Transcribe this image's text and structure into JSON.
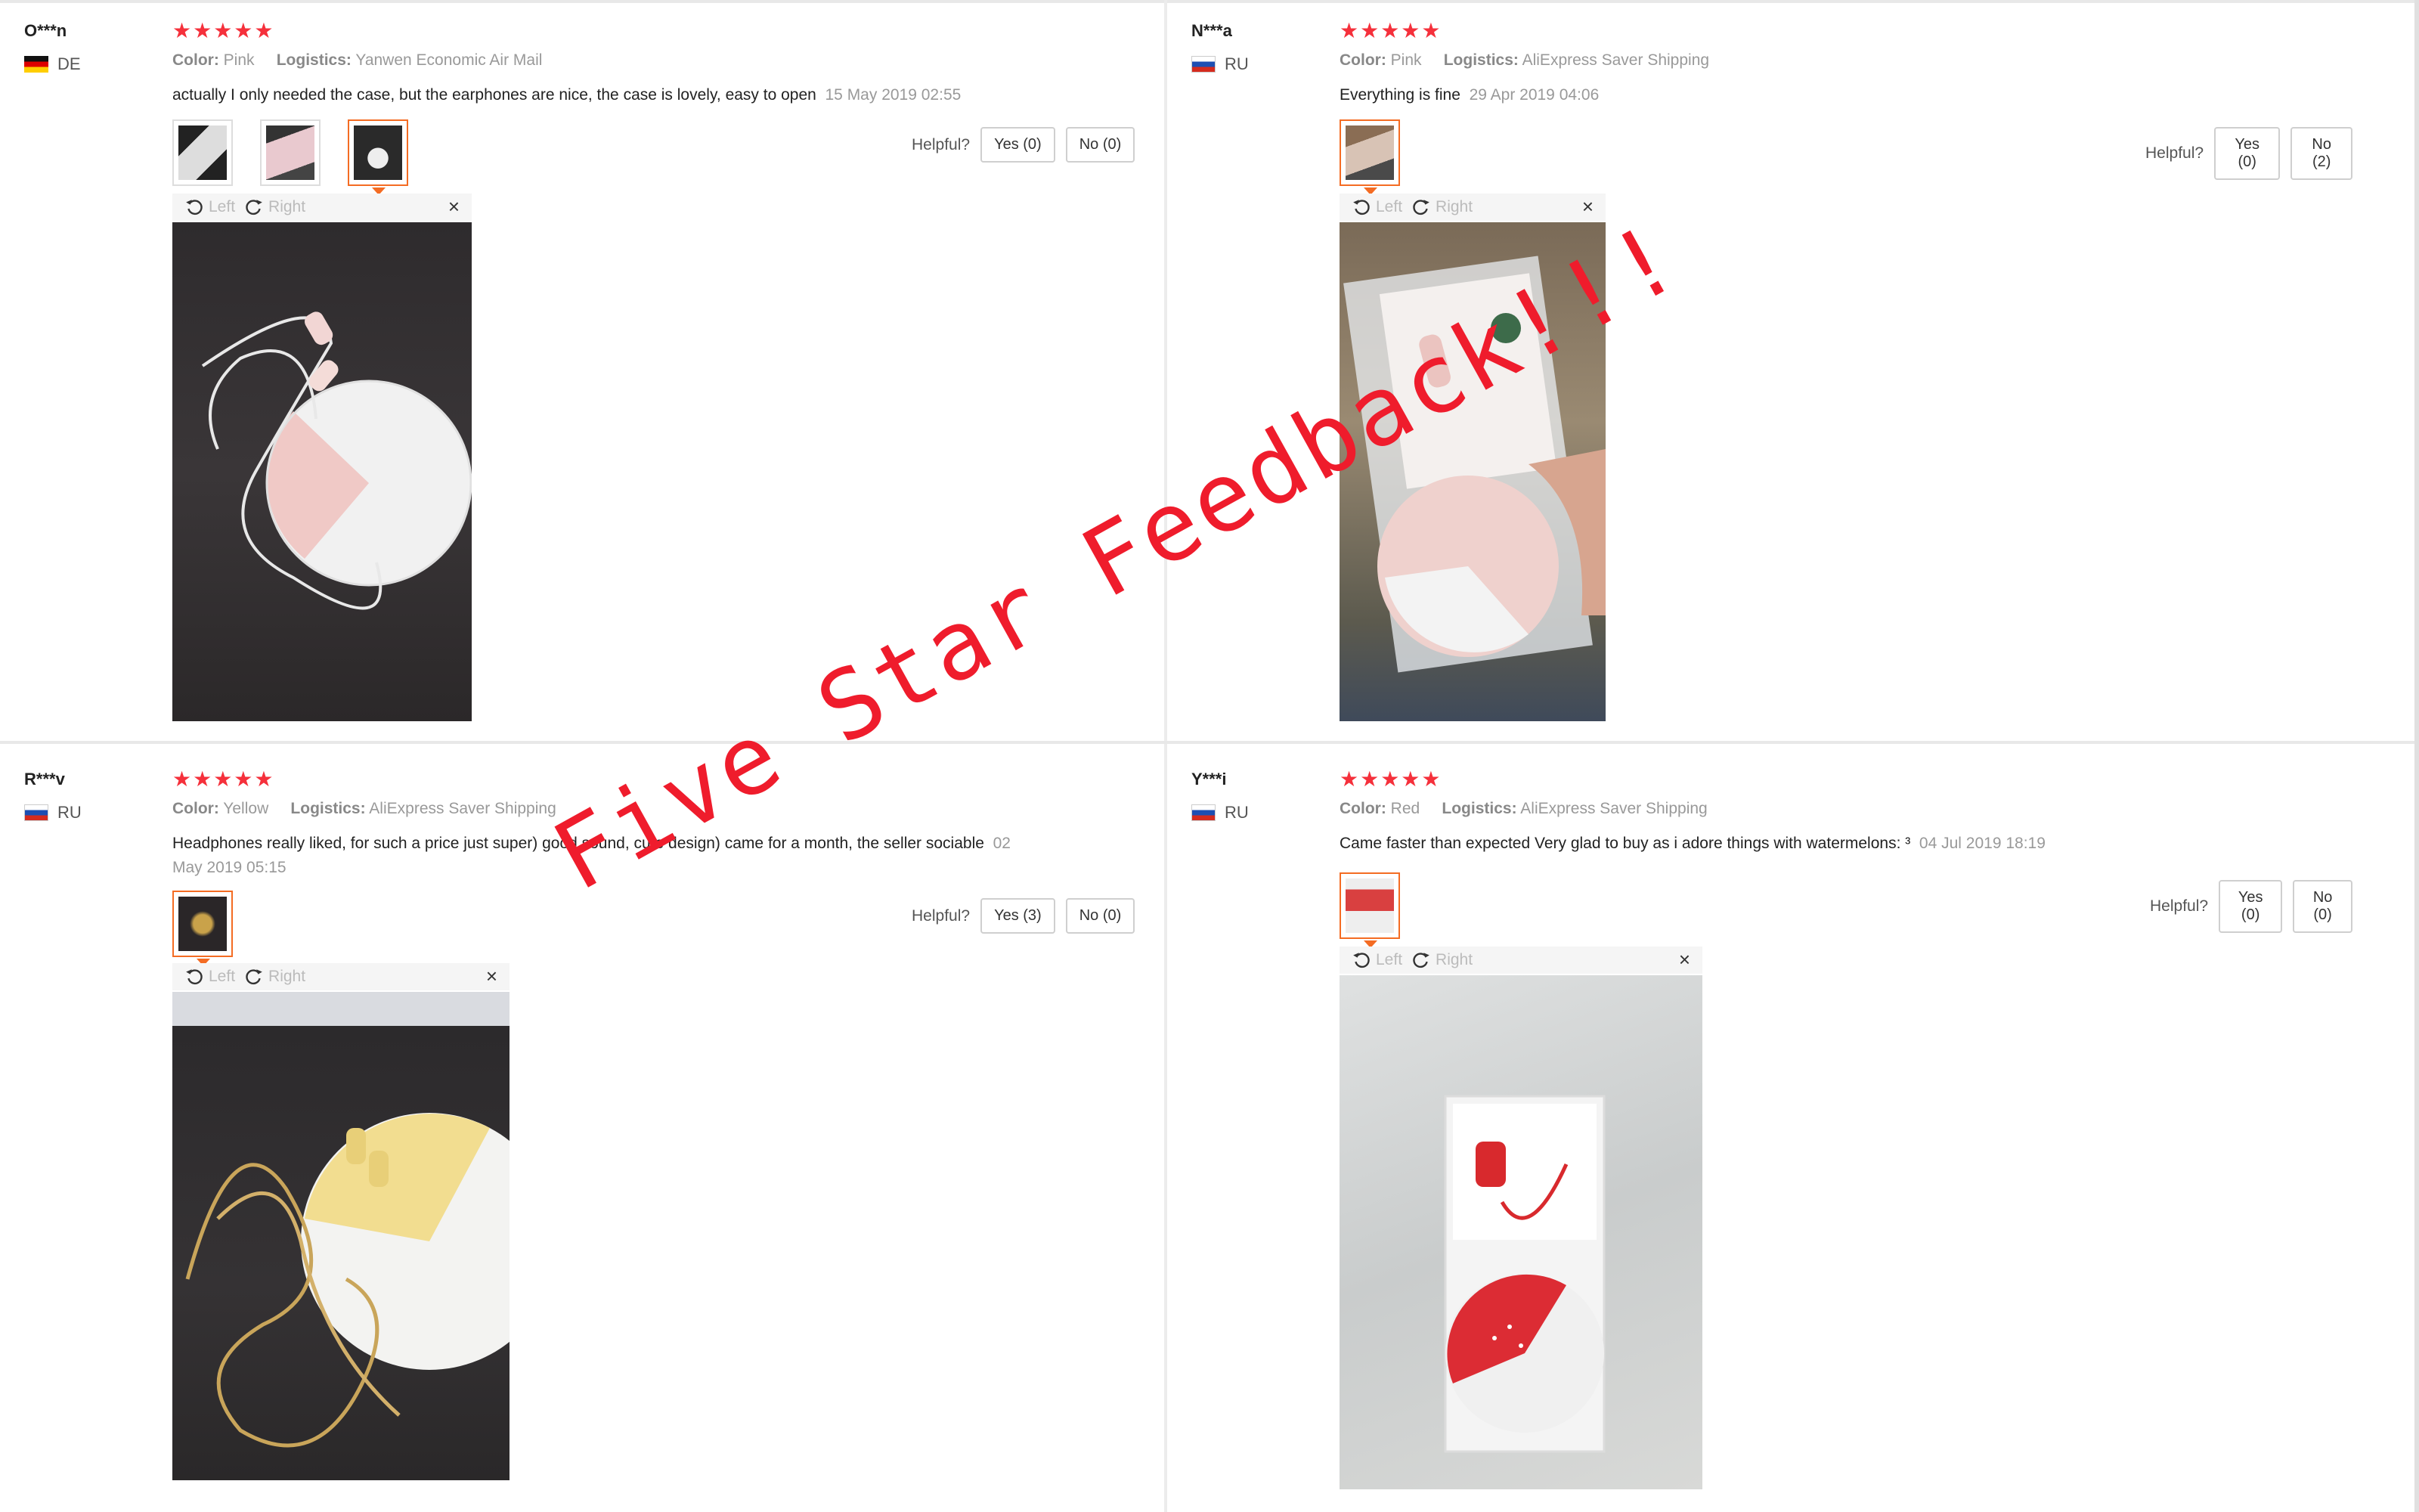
{
  "reviews": [
    {
      "user": "O***n",
      "country": "DE",
      "stars": "★★★★★",
      "color_label": "Color:",
      "color": "Pink",
      "logistics_label": "Logistics:",
      "logistics": "Yanwen Economic Air Mail",
      "text": "actually I only needed the case, but the earphones are nice, the case is lovely, easy to open",
      "date": "15 May 2019 02:55",
      "helpful": "Helpful?",
      "yes": "Yes (0)",
      "no": "No (0)",
      "left": "Left",
      "right": "Right"
    },
    {
      "user": "N***a",
      "country": "RU",
      "stars": "★★★★★",
      "color_label": "Color:",
      "color": "Pink",
      "logistics_label": "Logistics:",
      "logistics": "AliExpress Saver Shipping",
      "text": "Everything is fine",
      "date": "29 Apr 2019 04:06",
      "helpful": "Helpful?",
      "yes": "Yes (0)",
      "no": "No (2)",
      "left": "Left",
      "right": "Right"
    },
    {
      "user": "R***v",
      "country": "RU",
      "stars": "★★★★★",
      "color_label": "Color:",
      "color": "Yellow",
      "logistics_label": "Logistics:",
      "logistics": "AliExpress Saver Shipping",
      "text": "Headphones really liked, for such a price just super) good sound, cute design) came for a month, the seller sociable",
      "date": "02 May 2019 05:15",
      "helpful": "Helpful?",
      "yes": "Yes (3)",
      "no": "No (0)",
      "left": "Left",
      "right": "Right"
    },
    {
      "user": "Y***i",
      "country": "RU",
      "stars": "★★★★★",
      "color_label": "Color:",
      "color": "Red",
      "logistics_label": "Logistics:",
      "logistics": "AliExpress Saver Shipping",
      "text": "Came faster than expected Very glad to buy as i adore things with watermelons: ³",
      "date": "04 Jul 2019 18:19",
      "helpful": "Helpful?",
      "yes": "Yes (0)",
      "no": "No (0)",
      "left": "Left",
      "right": "Right"
    }
  ],
  "watermark": "Five Star Feedback!!!",
  "colors": {
    "star": "#f5303b",
    "active_thumb": "#f46c23",
    "watermark": "#ef1c2c"
  }
}
